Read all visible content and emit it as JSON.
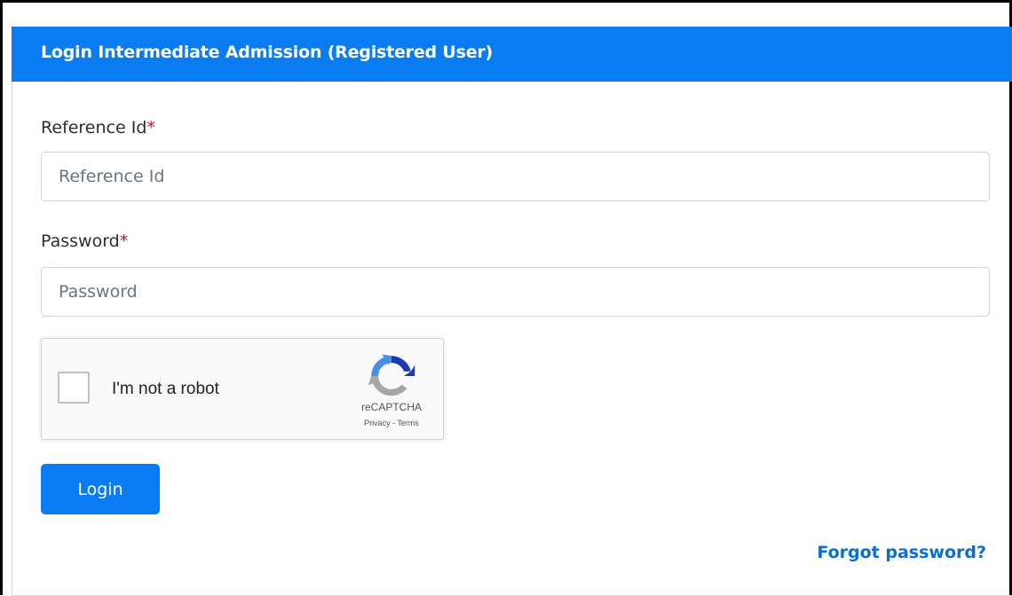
{
  "header": {
    "title": "Login Intermediate Admission (Registered User)"
  },
  "form": {
    "reference_id": {
      "label": "Reference Id",
      "required_mark": "*",
      "placeholder": "Reference Id",
      "value": ""
    },
    "password": {
      "label": "Password",
      "required_mark": "*",
      "placeholder": "Password",
      "value": ""
    },
    "recaptcha": {
      "checkbox_label": "I'm not a robot",
      "checked": false,
      "brand": "reCAPTCHA",
      "privacy_link": "Privacy",
      "separator": " - ",
      "terms_link": "Terms",
      "icon": "recaptcha-logo-icon"
    },
    "login_button": "Login",
    "forgot_password_link": "Forgot password?"
  },
  "colors": {
    "primary": "#0a7cf2",
    "link": "#0a6ed6",
    "required": "#c8102e"
  }
}
